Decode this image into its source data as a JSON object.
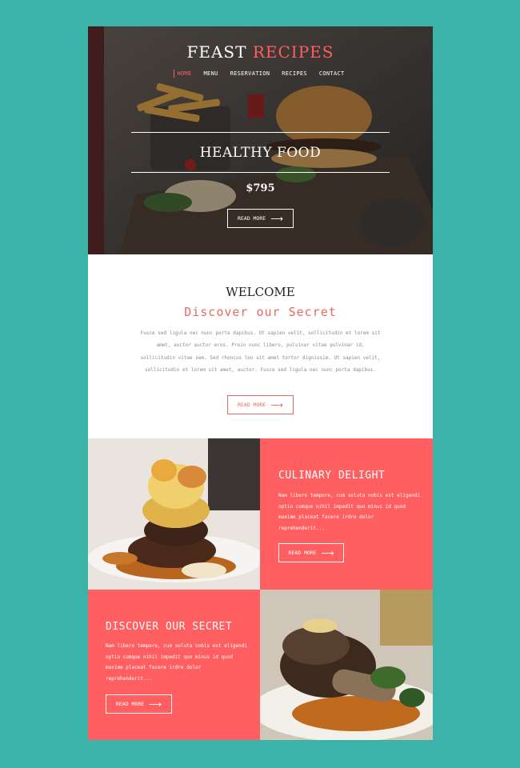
{
  "brand": {
    "part1": "FEAST",
    "part2": "RECIPES"
  },
  "nav": [
    {
      "label": "HOME",
      "active": true
    },
    {
      "label": "MENU"
    },
    {
      "label": "RESERVATION"
    },
    {
      "label": "RECIPES"
    },
    {
      "label": "CONTACT"
    }
  ],
  "hero": {
    "title": "HEALTHY FOOD",
    "price": "$795",
    "button": "READ MORE"
  },
  "welcome": {
    "title": "WELCOME",
    "subtitle": "Discover our Secret",
    "text": "Fusce sed ligula nec nunc porta dapibus. Ut sapien velit, sollicitudin et lorem sit amet, auctor auctor eros. Proin nunc libero, pulvinar vitae pulvinar id, sollicitudin vitae sem. Sed rhoncus leo sit amet tortor dignissim. Ut sapien velit, sollicitudin et lorem sit amet, auctor. Fusce sed ligula nec nunc porta dapibus.",
    "button": "READ MORE"
  },
  "feature1": {
    "title": "CULINARY DELIGHT",
    "text": "Nam libero tempore, cum soluta nobis est eligendi optio cumque nihil impedit quo minus id quod maxime placeat facere irdre dolor reprehenderit...",
    "button": "READ MORE"
  },
  "feature2": {
    "title": "DISCOVER OUR SECRET",
    "text": "Nam libero tempore, cum soluta nobis est eligendi optio cumque nihil impedit quo minus id quod maxime placeat facere irdre dolor reprehenderit...",
    "button": "READ MORE"
  },
  "colors": {
    "background": "#3bb3a8",
    "accent": "#ff5f61",
    "text_muted": "#8a8a8a"
  },
  "icons": {
    "arrow": "right-arrow-icon"
  }
}
